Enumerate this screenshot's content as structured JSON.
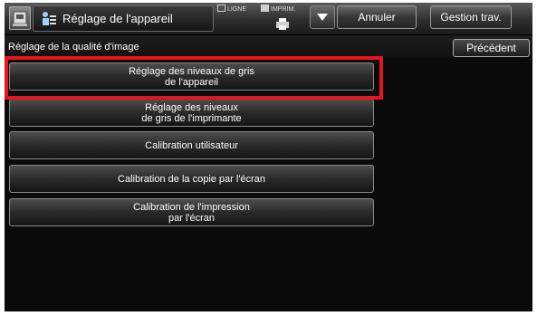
{
  "header": {
    "title": "Réglage de l'appareil",
    "status_line": "LIGNE",
    "status_print": "IMPRIM.",
    "cancel_label": "Annuler",
    "job_status_label": "Gestion trav."
  },
  "subheader": {
    "page_title": "Réglage de la qualité d'image",
    "back_label": "Précédent"
  },
  "menu": {
    "items": [
      {
        "label": "Réglage des niveaux de gris\nde l'appareil",
        "selected": true
      },
      {
        "label": "Réglage des niveaux\nde gris de l'imprimante",
        "selected": false
      },
      {
        "label": "Calibration utilisateur",
        "selected": false
      },
      {
        "label": "Calibration de la copie par l'écran",
        "selected": false
      },
      {
        "label": "Calibration de l'impression\npar l'écran",
        "selected": false
      }
    ]
  },
  "colors": {
    "highlight": "#e8141c",
    "background": "#0a0a0a"
  }
}
